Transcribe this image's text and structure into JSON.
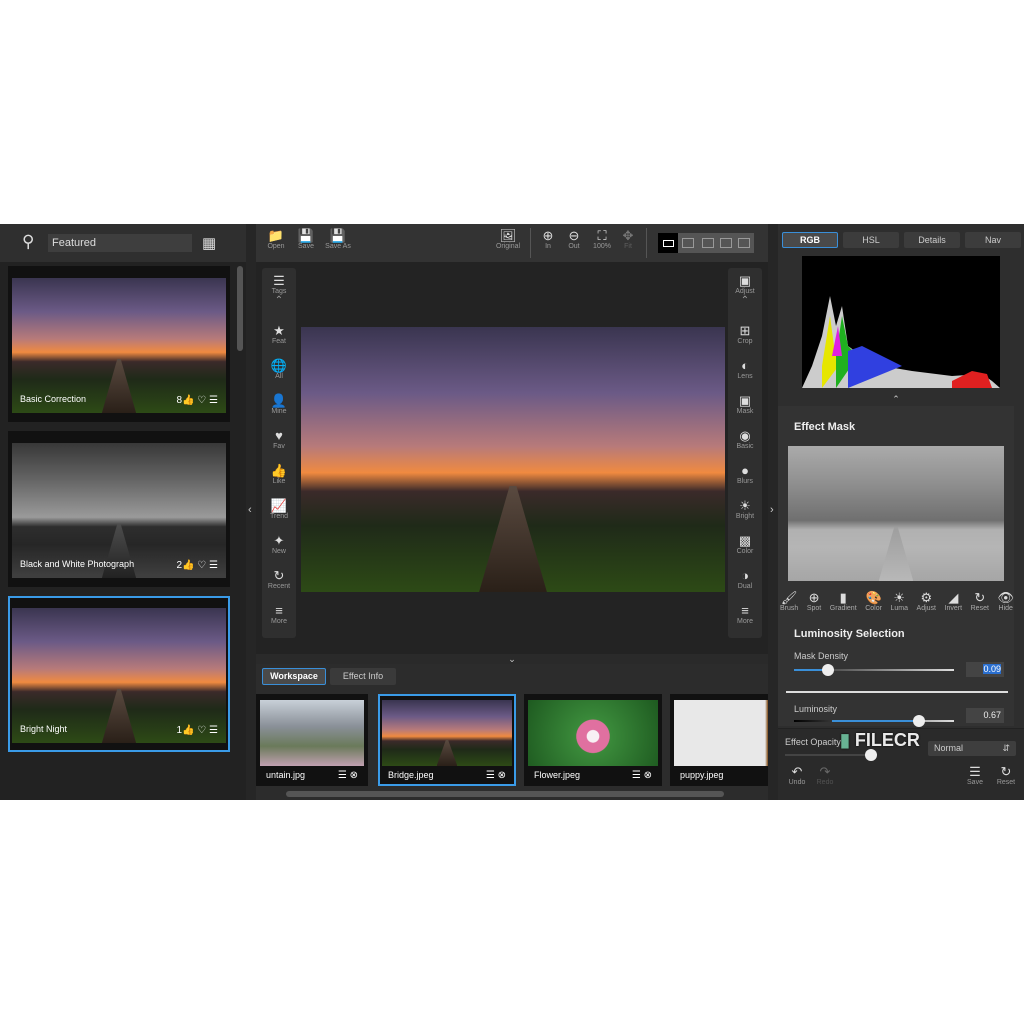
{
  "left": {
    "search_value": "Featured",
    "presets": [
      {
        "name": "Basic Correction",
        "likes": "8",
        "bw": false,
        "selected": false
      },
      {
        "name": "Black and White Photograph",
        "likes": "2",
        "bw": true,
        "selected": false
      },
      {
        "name": "Bright Night",
        "likes": "1",
        "bw": false,
        "selected": true
      }
    ]
  },
  "toolbar": {
    "open": "Open",
    "save": "Save",
    "save_as": "Save As",
    "original": "Original",
    "zoom_in": "In",
    "zoom_out": "Out",
    "zoom_100": "100%",
    "fit": "Fit"
  },
  "left_tools": [
    {
      "icon": "layers-icon",
      "label": "Tags"
    },
    {
      "icon": "star-icon",
      "label": "Feat"
    },
    {
      "icon": "globe-icon",
      "label": "All"
    },
    {
      "icon": "user-icon",
      "label": "Mine"
    },
    {
      "icon": "heart-icon",
      "label": "Fav"
    },
    {
      "icon": "thumbs-up-icon",
      "label": "Like"
    },
    {
      "icon": "trend-icon",
      "label": "Trend"
    },
    {
      "icon": "sparkle-icon",
      "label": "New"
    },
    {
      "icon": "clock-icon",
      "label": "Recent"
    },
    {
      "icon": "more-icon",
      "label": "More"
    }
  ],
  "right_tools": [
    {
      "icon": "toolbox-icon",
      "label": "Adjust"
    },
    {
      "icon": "crop-icon",
      "label": "Crop"
    },
    {
      "icon": "lens-icon",
      "label": "Lens"
    },
    {
      "icon": "mask-icon",
      "label": "Mask"
    },
    {
      "icon": "basic-icon",
      "label": "Basic"
    },
    {
      "icon": "blur-icon",
      "label": "Blurs"
    },
    {
      "icon": "sun-icon",
      "label": "Bright"
    },
    {
      "icon": "color-icon",
      "label": "Color"
    },
    {
      "icon": "dual-icon",
      "label": "Dual"
    },
    {
      "icon": "more-icon",
      "label": "More"
    }
  ],
  "bottom": {
    "tabs": [
      "Workspace",
      "Effect Info"
    ],
    "files": [
      "untain.jpg",
      "Bridge.jpeg",
      "Flower.jpeg",
      "puppy.jpeg"
    ]
  },
  "right": {
    "tabs": [
      "RGB",
      "HSL",
      "Details",
      "Nav"
    ],
    "effect_mask": "Effect Mask",
    "mask_tools": [
      "Brush",
      "Spot",
      "Gradient",
      "Color",
      "Luma",
      "Adjust",
      "Invert",
      "Reset",
      "Hide"
    ],
    "luminosity_selection": "Luminosity Selection",
    "mask_density_label": "Mask Density",
    "mask_density": "0.09",
    "mask_density_fraction": 0.09,
    "luminosity_label": "Luminosity",
    "luminosity": "0.67",
    "luminosity_fraction": 0.67,
    "effect_opacity_label": "Effect Opacity",
    "blend_mode": "Normal",
    "undo": "Undo",
    "redo": "Redo",
    "save": "Save",
    "reset": "Reset"
  },
  "watermark": "FILECR .com"
}
